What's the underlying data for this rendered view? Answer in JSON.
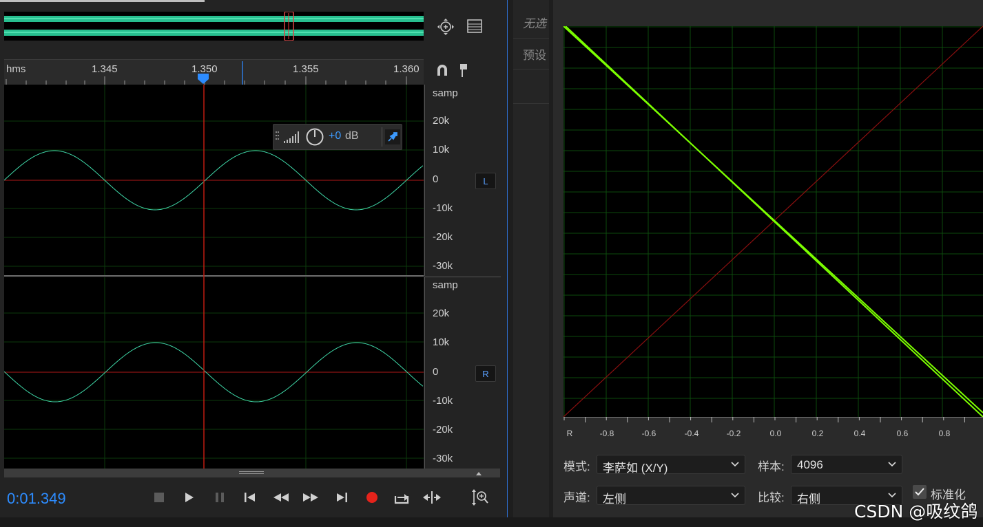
{
  "overview": {
    "zoom_icon": "zoom-navigator-icon",
    "spectral_icon": "spectral-view-icon"
  },
  "ruler": {
    "unit": "hms",
    "ticks": [
      "1.345",
      "1.350",
      "1.355",
      "1.360"
    ],
    "snap_icon": "magnet-icon",
    "marker_icon": "marker-pin-icon"
  },
  "gain_hud": {
    "value": "+0",
    "unit": "dB"
  },
  "channels": [
    {
      "name": "L",
      "scale_unit": "samp",
      "scale": [
        "20k",
        "10k",
        "0",
        "-10k",
        "-20k",
        "-30k"
      ]
    },
    {
      "name": "R",
      "scale_unit": "samp",
      "scale": [
        "20k",
        "10k",
        "0",
        "-10k",
        "-20k",
        "-30k"
      ]
    }
  ],
  "transport": {
    "timecode": "0:01.349",
    "buttons": [
      "stop",
      "play",
      "pause",
      "to-start",
      "rewind",
      "fast-forward",
      "to-end",
      "record",
      "loop",
      "skip-selection",
      "zoom-amplitude"
    ]
  },
  "midpanel": {
    "item1": "无选",
    "item2": "预设"
  },
  "phase_meter": {
    "x_ticks": [
      "R",
      "-0.8",
      "-0.6",
      "-0.4",
      "-0.2",
      "0.0",
      "0.2",
      "0.4",
      "0.6",
      "0.8"
    ],
    "mode_label": "模式:",
    "mode_value": "李萨如 (X/Y)",
    "samples_label": "样本:",
    "samples_value": "4096",
    "channel_label": "声道:",
    "channel_value": "左侧",
    "compare_label": "比较:",
    "compare_value": "右侧",
    "normalize_label": "标准化",
    "normalize_checked": true
  },
  "colors": {
    "waveform": "#3fd8a8",
    "accent": "#2d8cff",
    "playhead": "#c01c10",
    "xy_trace": "#7cff00",
    "grid": "#0d4a0d"
  },
  "watermark": "CSDN @吸纹鸽"
}
